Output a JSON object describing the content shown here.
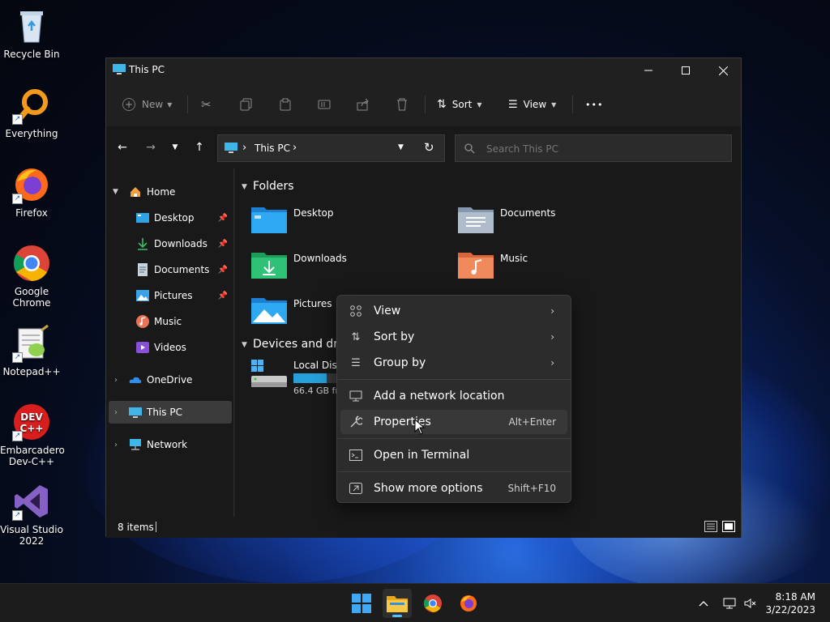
{
  "desktop": {
    "icons": [
      {
        "label": "Recycle Bin"
      },
      {
        "label": "Everything"
      },
      {
        "label": "Firefox"
      },
      {
        "label": "Google Chrome"
      },
      {
        "label": "Notepad++"
      },
      {
        "label": "Embarcadero Dev-C++"
      },
      {
        "label": "Visual Studio 2022"
      }
    ]
  },
  "window": {
    "title": "This PC",
    "toolbar": {
      "new_label": "New",
      "sort_label": "Sort",
      "view_label": "View",
      "more_label": "•••"
    },
    "address": {
      "location": "This PC",
      "separator": "›"
    },
    "search": {
      "placeholder": "Search This PC"
    },
    "sidebar": {
      "home": "Home",
      "quick_access": [
        {
          "label": "Desktop"
        },
        {
          "label": "Downloads"
        },
        {
          "label": "Documents"
        },
        {
          "label": "Pictures"
        },
        {
          "label": "Music"
        },
        {
          "label": "Videos"
        }
      ],
      "onedrive": "OneDrive",
      "this_pc": "This PC",
      "network": "Network"
    },
    "content": {
      "folders_header": "Folders",
      "folders": [
        {
          "label": "Desktop"
        },
        {
          "label": "Documents"
        },
        {
          "label": "Downloads"
        },
        {
          "label": "Music"
        },
        {
          "label": "Pictures"
        }
      ],
      "devices_header": "Devices and dri",
      "drive": {
        "label": "Local Disk",
        "free_text": "66.4 GB fre",
        "used_fraction": 0.75
      }
    },
    "status": {
      "items": "8 items"
    }
  },
  "context_menu": {
    "items": [
      {
        "label": "View",
        "submenu": true
      },
      {
        "label": "Sort by",
        "submenu": true
      },
      {
        "label": "Group by",
        "submenu": true
      },
      {
        "label": "Add a network location"
      },
      {
        "label": "Properties",
        "shortcut": "Alt+Enter"
      },
      {
        "label": "Open in Terminal"
      },
      {
        "label": "Show more options",
        "shortcut": "Shift+F10"
      }
    ]
  },
  "taskbar": {
    "time": "8:18 AM",
    "date": "3/22/2023"
  },
  "colors": {
    "accent": "#0078d4",
    "menu_bg": "#2c2c2c",
    "window_bg": "#202020"
  }
}
